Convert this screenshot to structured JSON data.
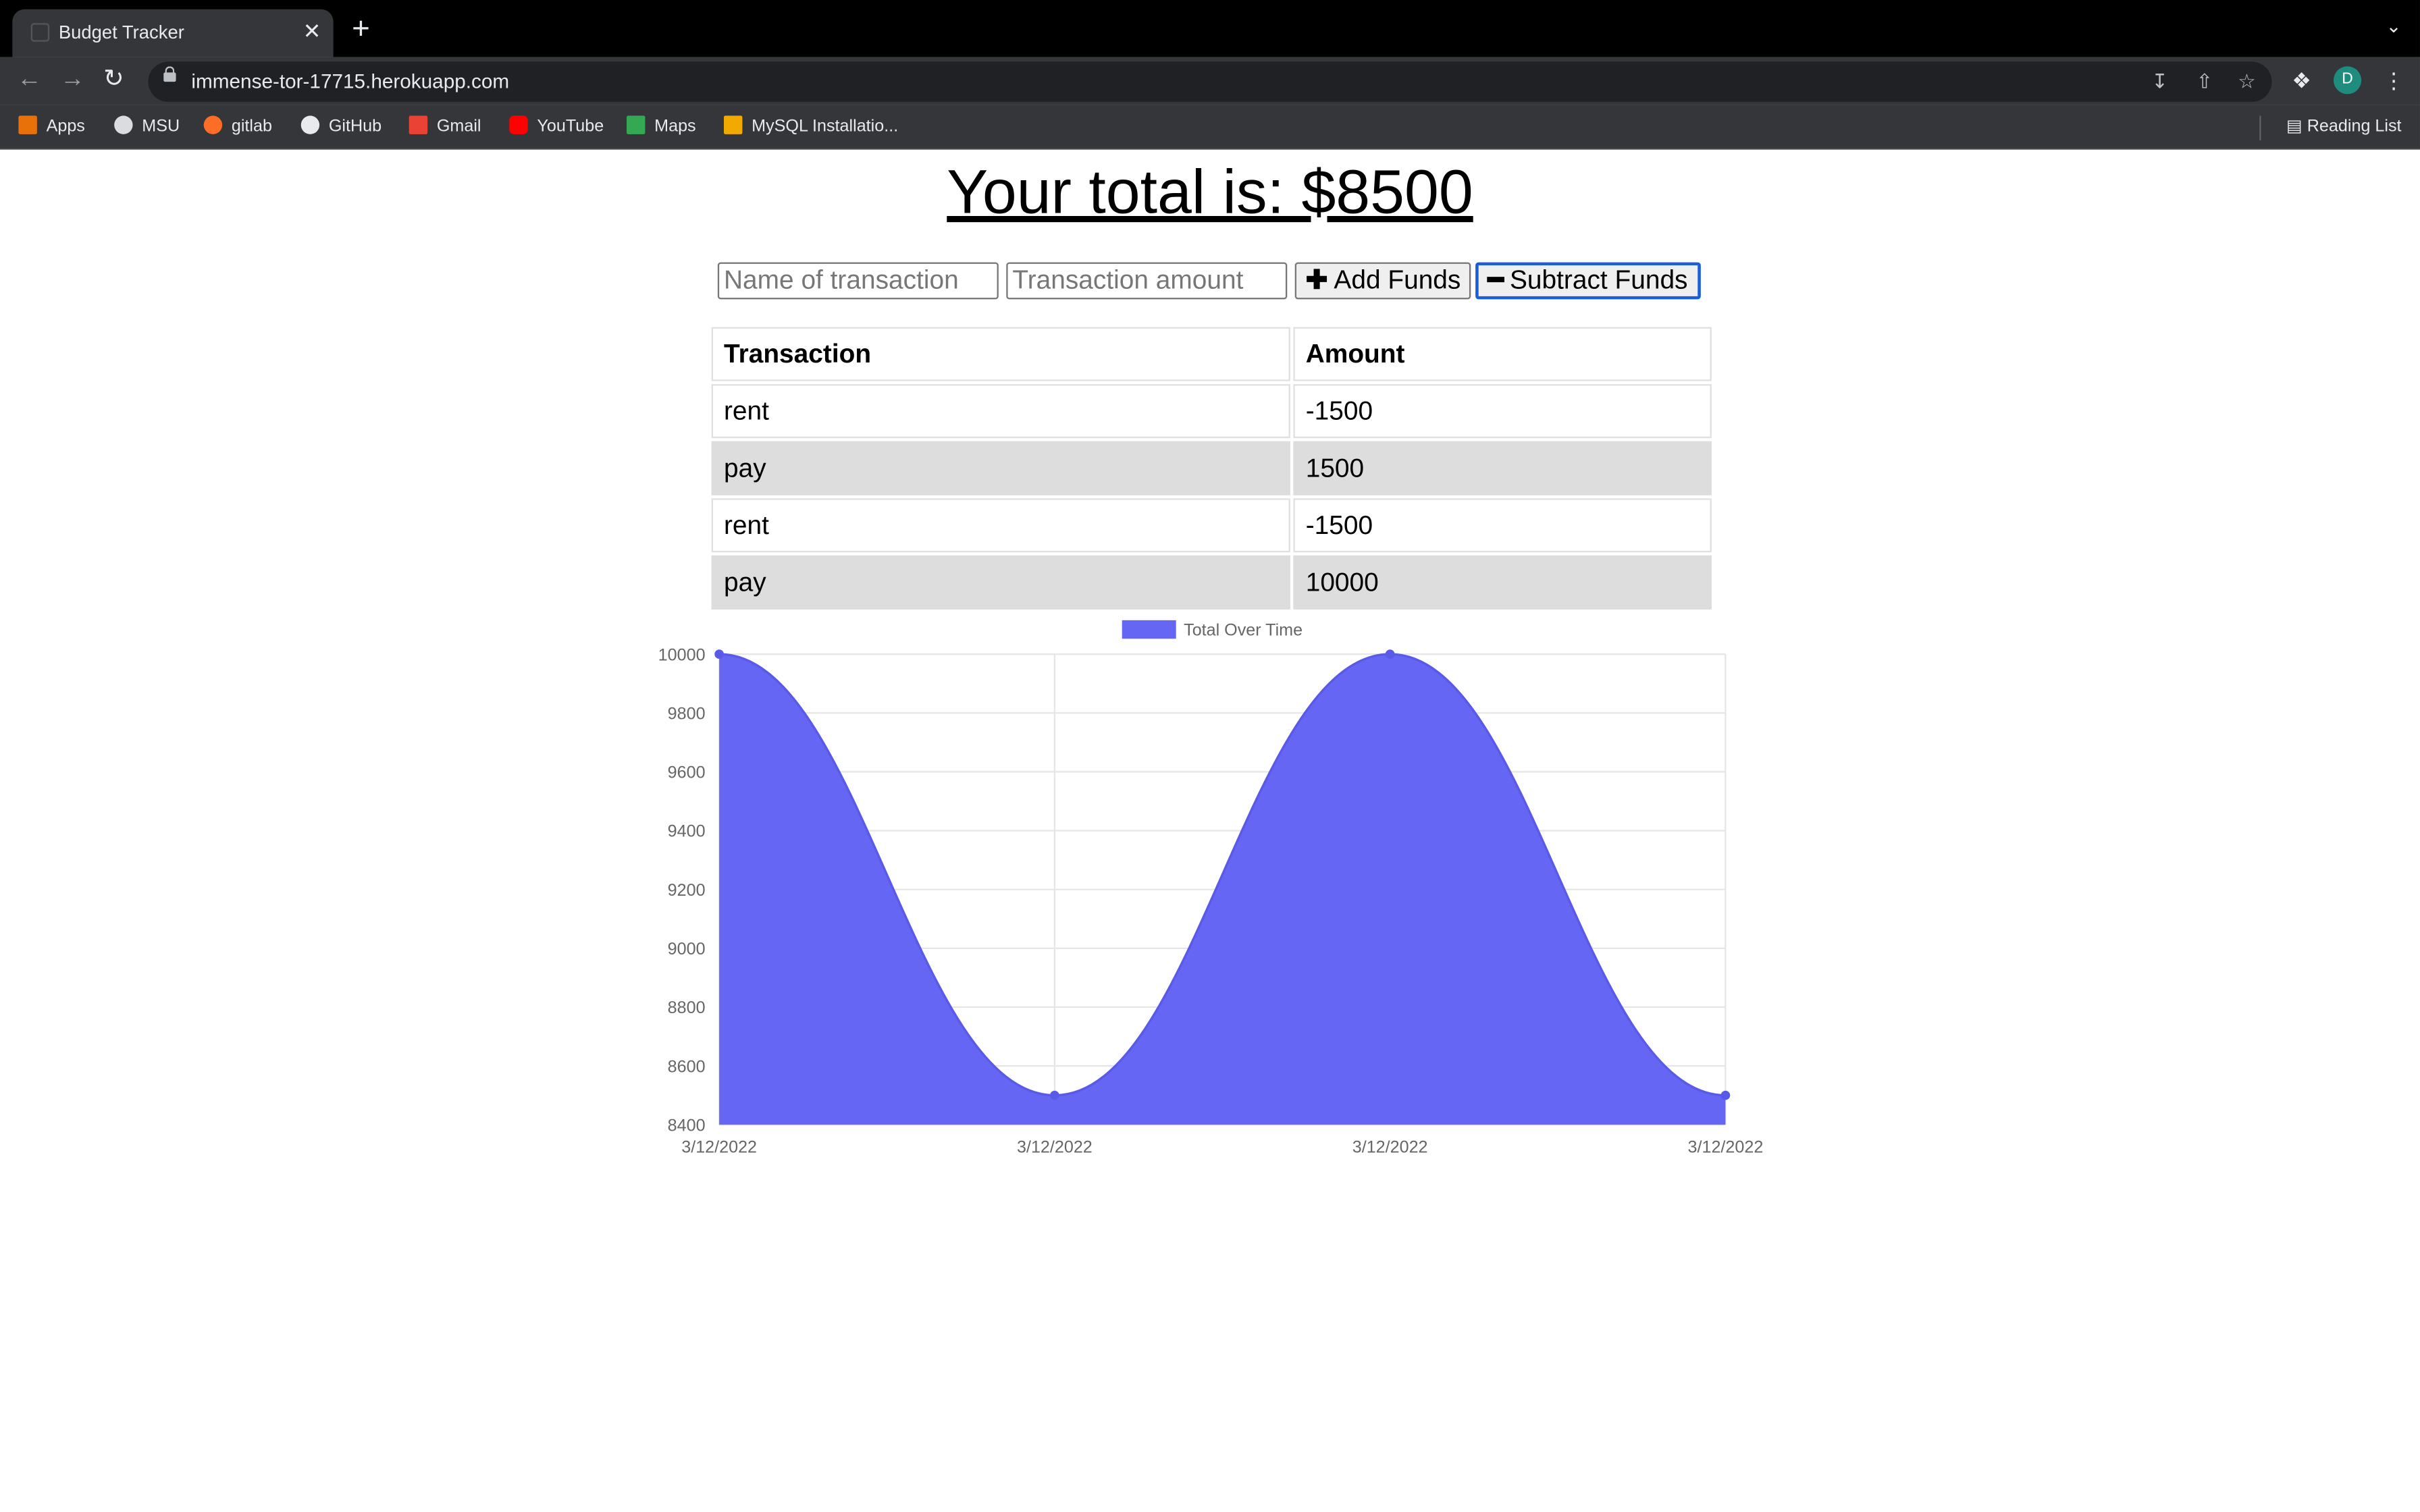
{
  "browser": {
    "tab_title": "Budget Tracker",
    "tab_close": "✕",
    "new_tab": "+",
    "url": "immense-tor-17715.herokuapp.com",
    "avatar_letter": "D",
    "bookmarks": [
      {
        "label": "Apps",
        "color": "#e8710a"
      },
      {
        "label": "MSU",
        "color": "#dadce0"
      },
      {
        "label": "gitlab",
        "color": "#fc6d26"
      },
      {
        "label": "GitHub",
        "color": "#e8eaed"
      },
      {
        "label": "Gmail",
        "color": "#ea4335"
      },
      {
        "label": "YouTube",
        "color": "#ff0000"
      },
      {
        "label": "Maps",
        "color": "#34a853"
      },
      {
        "label": "MySQL Installatio...",
        "color": "#f2a900"
      }
    ],
    "reading_list": "Reading List"
  },
  "page": {
    "total_text": "Your total is: $8500",
    "name_placeholder": "Name of transaction",
    "amount_placeholder": "Transaction amount",
    "add_label": "Add Funds",
    "add_glyph": "✚",
    "subtract_label": "Subtract Funds",
    "subtract_glyph": "━",
    "table_headers": [
      "Transaction",
      "Amount"
    ],
    "transactions": [
      {
        "name": "rent",
        "amount": "-1500"
      },
      {
        "name": "pay",
        "amount": "1500"
      },
      {
        "name": "rent",
        "amount": "-1500"
      },
      {
        "name": "pay",
        "amount": "10000"
      }
    ]
  },
  "chart_data": {
    "type": "area",
    "legend": "Total Over Time",
    "legend_position": "top",
    "fill_color": "#6666f5",
    "categories": [
      "3/12/2022",
      "3/12/2022",
      "3/12/2022",
      "3/12/2022"
    ],
    "series": [
      {
        "name": "Total Over Time",
        "values": [
          10000,
          8500,
          10000,
          8500
        ]
      }
    ],
    "ylim": [
      8400,
      10000
    ],
    "yticks": [
      10000,
      9800,
      9600,
      9400,
      9200,
      9000,
      8800,
      8600,
      8400
    ],
    "grid": true
  }
}
